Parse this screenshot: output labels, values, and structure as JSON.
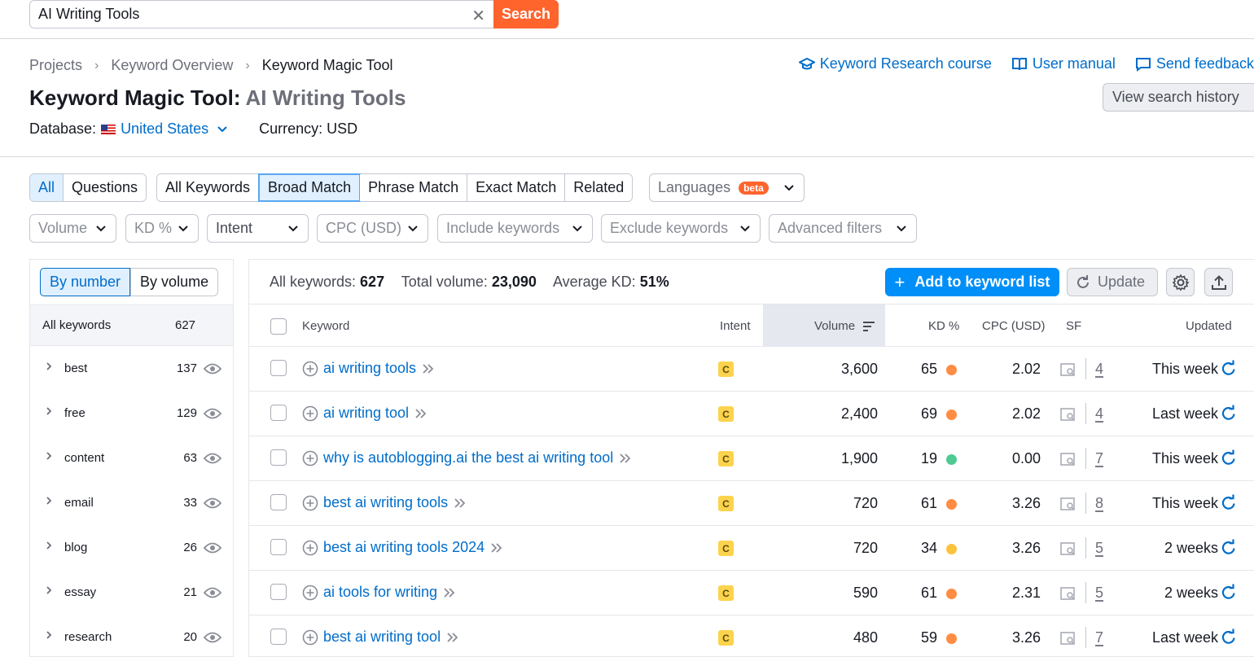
{
  "search": {
    "query": "AI Writing Tools",
    "button": "Search"
  },
  "breadcrumb": [
    "Projects",
    "Keyword Overview",
    "Keyword Magic Tool"
  ],
  "head_links": {
    "course": "Keyword Research course",
    "manual": "User manual",
    "feedback": "Send feedback"
  },
  "title": {
    "tool": "Keyword Magic Tool:",
    "query": "AI Writing Tools"
  },
  "history_button": "View search history",
  "database": {
    "label": "Database:",
    "value": "United States",
    "currency": "Currency: USD"
  },
  "filters": {
    "type_group": [
      "All",
      "Questions"
    ],
    "match_group": [
      "All Keywords",
      "Broad Match",
      "Phrase Match",
      "Exact Match",
      "Related"
    ],
    "languages": "Languages",
    "beta": "beta",
    "dropdowns": [
      "Volume",
      "KD %",
      "Intent",
      "CPC (USD)",
      "Include keywords",
      "Exclude keywords",
      "Advanced filters"
    ]
  },
  "left_panel": {
    "toggle": [
      "By number",
      "By volume"
    ],
    "all_label": "All keywords",
    "all_count": "627",
    "groups": [
      {
        "label": "best",
        "count": "137"
      },
      {
        "label": "free",
        "count": "129"
      },
      {
        "label": "content",
        "count": "63"
      },
      {
        "label": "email",
        "count": "33"
      },
      {
        "label": "blog",
        "count": "26"
      },
      {
        "label": "essay",
        "count": "21"
      },
      {
        "label": "research",
        "count": "20"
      }
    ]
  },
  "summary": {
    "all_label": "All keywords:",
    "all_value": "627",
    "volume_label": "Total volume:",
    "volume_value": "23,090",
    "kd_label": "Average KD:",
    "kd_value": "51%"
  },
  "actions": {
    "add": "Add to keyword list",
    "update": "Update"
  },
  "columns": {
    "keyword": "Keyword",
    "intent": "Intent",
    "volume": "Volume",
    "kd": "KD %",
    "cpc": "CPC (USD)",
    "sf": "SF",
    "updated": "Updated"
  },
  "rows": [
    {
      "keyword": "ai writing tools",
      "intent": "C",
      "volume": "3,600",
      "kd": "65",
      "kd_color": "#ff8c43",
      "cpc": "2.02",
      "sf": "4",
      "updated": "This week"
    },
    {
      "keyword": "ai writing tool",
      "intent": "C",
      "volume": "2,400",
      "kd": "69",
      "kd_color": "#ff8c43",
      "cpc": "2.02",
      "sf": "4",
      "updated": "Last week"
    },
    {
      "keyword": "why is autoblogging.ai the best ai writing tool",
      "intent": "C",
      "volume": "1,900",
      "kd": "19",
      "kd_color": "#4fcb91",
      "cpc": "0.00",
      "sf": "7",
      "updated": "This week"
    },
    {
      "keyword": "best ai writing tools",
      "intent": "C",
      "volume": "720",
      "kd": "61",
      "kd_color": "#ff8c43",
      "cpc": "3.26",
      "sf": "8",
      "updated": "This week"
    },
    {
      "keyword": "best ai writing tools 2024",
      "intent": "C",
      "volume": "720",
      "kd": "34",
      "kd_color": "#fdc23c",
      "cpc": "3.26",
      "sf": "5",
      "updated": "2 weeks"
    },
    {
      "keyword": "ai tools for writing",
      "intent": "C",
      "volume": "590",
      "kd": "61",
      "kd_color": "#ff8c43",
      "cpc": "2.31",
      "sf": "5",
      "updated": "2 weeks"
    },
    {
      "keyword": "best ai writing tool",
      "intent": "C",
      "volume": "480",
      "kd": "59",
      "kd_color": "#ff8c43",
      "cpc": "3.26",
      "sf": "7",
      "updated": "Last week"
    }
  ],
  "colors": {
    "accent": "#006dca",
    "brand_orange": "#ff642d",
    "primary_button": "#008ff8"
  }
}
